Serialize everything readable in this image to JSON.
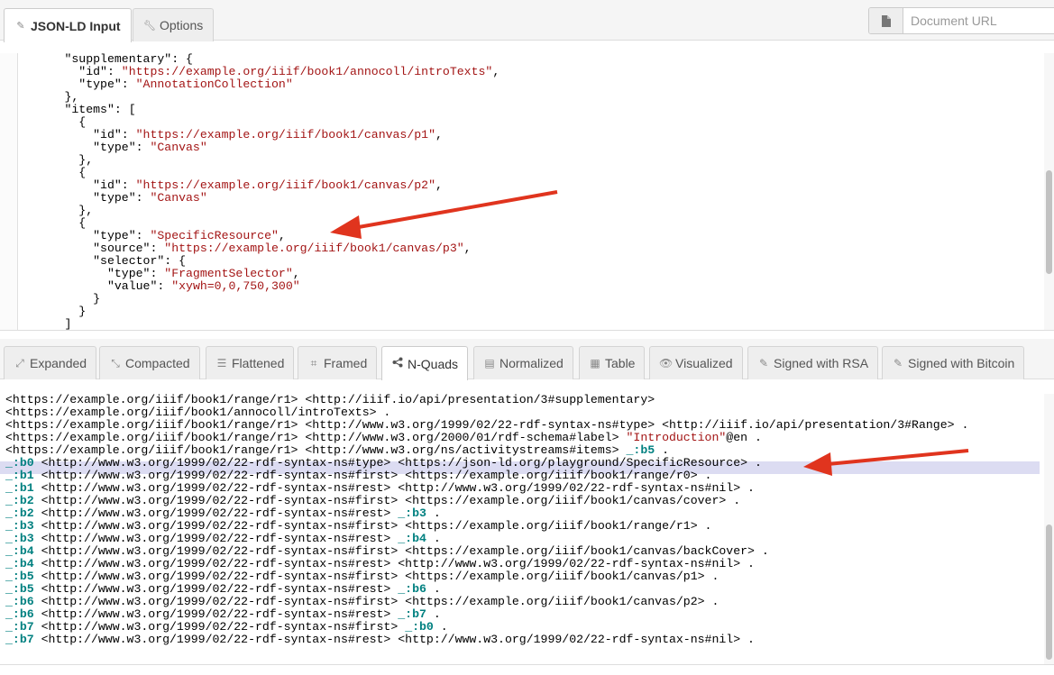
{
  "top_tabs": [
    {
      "label": "JSON-LD Input",
      "icon": "pencil-icon",
      "active": true
    },
    {
      "label": "Options",
      "icon": "wrench-icon",
      "active": false
    }
  ],
  "document_url": {
    "placeholder": "Document URL",
    "value": "",
    "icon": "file-icon"
  },
  "input_editor": {
    "lines": [
      "      \"supplementary\": {",
      "        \"id\": \"https://example.org/iiif/book1/annocoll/introTexts\",",
      "        \"type\": \"AnnotationCollection\"",
      "      },",
      "      \"items\": [",
      "        {",
      "          \"id\": \"https://example.org/iiif/book1/canvas/p1\",",
      "          \"type\": \"Canvas\"",
      "        },",
      "        {",
      "          \"id\": \"https://example.org/iiif/book1/canvas/p2\",",
      "          \"type\": \"Canvas\"",
      "        },",
      "        {",
      "          \"type\": \"SpecificResource\",",
      "          \"source\": \"https://example.org/iiif/book1/canvas/p3\",",
      "          \"selector\": {",
      "            \"type\": \"FragmentSelector\",",
      "            \"value\": \"xywh=0,0,750,300\"",
      "          }",
      "        }",
      "      ]"
    ]
  },
  "output_tabs": [
    {
      "label": "Expanded",
      "icon": "expand-icon",
      "active": false
    },
    {
      "label": "Compacted",
      "icon": "compress-icon",
      "active": false
    },
    {
      "label": "Flattened",
      "icon": "list-icon",
      "active": false
    },
    {
      "label": "Framed",
      "icon": "crop-icon",
      "active": false
    },
    {
      "label": "N-Quads",
      "icon": "share-icon",
      "active": true
    },
    {
      "label": "Normalized",
      "icon": "table-header-icon",
      "active": false
    },
    {
      "label": "Table",
      "icon": "grid-icon",
      "active": false
    },
    {
      "label": "Visualized",
      "icon": "eye-icon",
      "active": false
    },
    {
      "label": "Signed with RSA",
      "icon": "pencil-icon",
      "active": false
    },
    {
      "label": "Signed with Bitcoin",
      "icon": "pencil-icon",
      "active": false
    }
  ],
  "output_editor": {
    "lines": [
      "<https://example.org/iiif/book1/range/r1> <http://iiif.io/api/presentation/3#supplementary>",
      "<https://example.org/iiif/book1/annocoll/introTexts> .",
      "<https://example.org/iiif/book1/range/r1> <http://www.w3.org/1999/02/22-rdf-syntax-ns#type> <http://iiif.io/api/presentation/3#Range> .",
      "<https://example.org/iiif/book1/range/r1> <http://www.w3.org/2000/01/rdf-schema#label> \"Introduction\"@en .",
      "<https://example.org/iiif/book1/range/r1> <http://www.w3.org/ns/activitystreams#items> _:b5 .",
      "_:b0 <http://www.w3.org/1999/02/22-rdf-syntax-ns#type> <https://json-ld.org/playground/SpecificResource> .",
      "_:b1 <http://www.w3.org/1999/02/22-rdf-syntax-ns#first> <https://example.org/iiif/book1/range/r0> .",
      "_:b1 <http://www.w3.org/1999/02/22-rdf-syntax-ns#rest> <http://www.w3.org/1999/02/22-rdf-syntax-ns#nil> .",
      "_:b2 <http://www.w3.org/1999/02/22-rdf-syntax-ns#first> <https://example.org/iiif/book1/canvas/cover> .",
      "_:b2 <http://www.w3.org/1999/02/22-rdf-syntax-ns#rest> _:b3 .",
      "_:b3 <http://www.w3.org/1999/02/22-rdf-syntax-ns#first> <https://example.org/iiif/book1/range/r1> .",
      "_:b3 <http://www.w3.org/1999/02/22-rdf-syntax-ns#rest> _:b4 .",
      "_:b4 <http://www.w3.org/1999/02/22-rdf-syntax-ns#first> <https://example.org/iiif/book1/canvas/backCover> .",
      "_:b4 <http://www.w3.org/1999/02/22-rdf-syntax-ns#rest> <http://www.w3.org/1999/02/22-rdf-syntax-ns#nil> .",
      "_:b5 <http://www.w3.org/1999/02/22-rdf-syntax-ns#first> <https://example.org/iiif/book1/canvas/p1> .",
      "_:b5 <http://www.w3.org/1999/02/22-rdf-syntax-ns#rest> _:b6 .",
      "_:b6 <http://www.w3.org/1999/02/22-rdf-syntax-ns#first> <https://example.org/iiif/book1/canvas/p2> .",
      "_:b6 <http://www.w3.org/1999/02/22-rdf-syntax-ns#rest> _:b7 .",
      "_:b7 <http://www.w3.org/1999/02/22-rdf-syntax-ns#first> _:b0 .",
      "_:b7 <http://www.w3.org/1999/02/22-rdf-syntax-ns#rest> <http://www.w3.org/1999/02/22-rdf-syntax-ns#nil> ."
    ],
    "highlighted_line": 5
  },
  "colors": {
    "arrow": "#e0341e",
    "string": "#a31515",
    "blank_node": "#008080",
    "highlight": "#dcdcf2"
  }
}
